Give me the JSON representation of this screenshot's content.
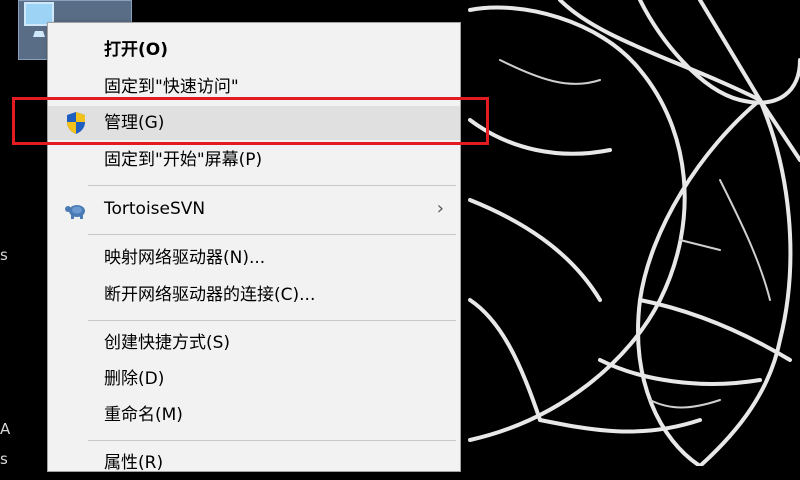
{
  "menu": {
    "items": [
      {
        "label": "打开(O)",
        "bold": true
      },
      {
        "label": "固定到\"快速访问\""
      },
      {
        "label": "管理(G)",
        "icon": "shield-icon",
        "highlighted": true
      },
      {
        "label": "固定到\"开始\"屏幕(P)"
      },
      {
        "label": "TortoiseSVN",
        "icon": "tortoise-icon",
        "submenu": true
      },
      {
        "label": "映射网络驱动器(N)..."
      },
      {
        "label": "断开网络驱动器的连接(C)..."
      },
      {
        "label": "创建快捷方式(S)"
      },
      {
        "label": "删除(D)"
      },
      {
        "label": "重命名(M)"
      },
      {
        "label": "属性(R)"
      }
    ]
  },
  "desktop": {
    "edge_letters": [
      "s",
      "A",
      "s"
    ]
  },
  "colors": {
    "highlight": "#e31b23",
    "menu_bg": "#f2f2f2",
    "shield_blue": "#1f5fbf",
    "shield_yellow": "#f2c21b"
  }
}
